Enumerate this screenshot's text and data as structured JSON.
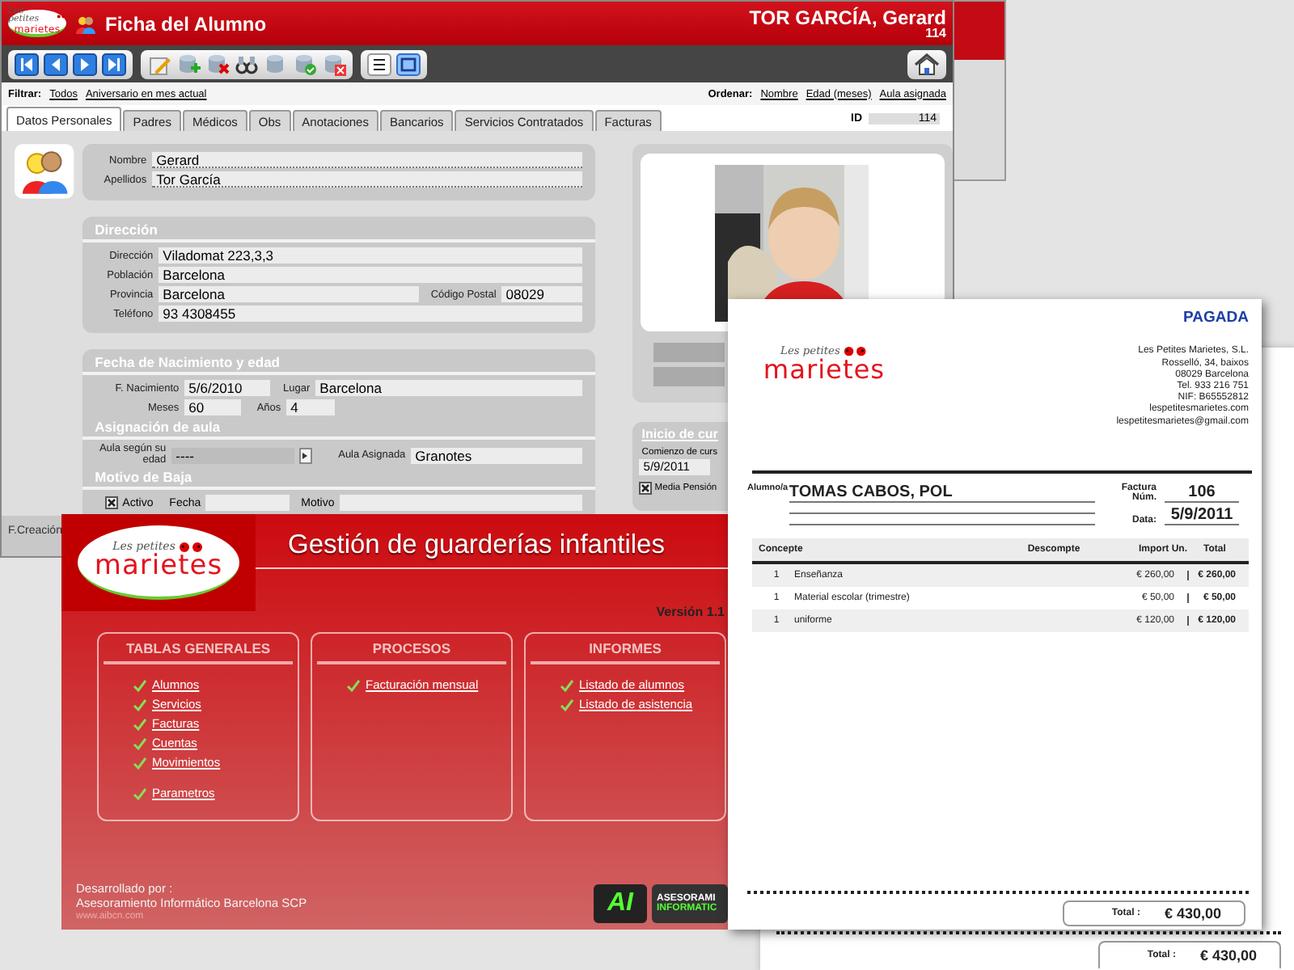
{
  "student_window": {
    "logo": {
      "top": "Les petites",
      "main": "marietes"
    },
    "title": "Ficha del Alumno",
    "student_name": "TOR GARCÍA, Gerard",
    "student_number": "114",
    "view_toggle": [
      {
        "selected": false
      },
      {
        "selected": true
      }
    ],
    "filter": {
      "label": "Filtrar:",
      "options": [
        "Todos",
        "Aniversario en mes actual"
      ]
    },
    "sort": {
      "label": "Ordenar:",
      "options": [
        "Nombre",
        "Edad (meses)",
        "Aula asignada"
      ]
    },
    "tabs": [
      {
        "label": "Datos Personales",
        "selected": true
      },
      {
        "label": "Padres",
        "selected": false
      },
      {
        "label": "Médicos",
        "selected": false
      },
      {
        "label": "Obs",
        "selected": false
      },
      {
        "label": "Anotaciones",
        "selected": false
      },
      {
        "label": "Bancarios",
        "selected": false
      },
      {
        "label": "Servicios Contratados",
        "selected": false
      },
      {
        "label": "Facturas",
        "selected": false
      }
    ],
    "id_label": "ID",
    "id_value": "114",
    "name_fields": [
      {
        "label": "Nombre",
        "value": "Gerard"
      },
      {
        "label": "Apellidos",
        "value": "Tor García"
      }
    ],
    "address": {
      "title": "Dirección",
      "rows": [
        [
          {
            "label": "Dirección",
            "value": "Viladomat 223,3,3"
          }
        ],
        [
          {
            "label": "Población",
            "value": "Barcelona"
          }
        ],
        [
          {
            "label": "Provincia",
            "value": "Barcelona"
          },
          {
            "label": "Código Postal",
            "value": "08029"
          }
        ],
        [
          {
            "label": "Teléfono",
            "value": "93 4308455"
          }
        ]
      ]
    },
    "birth": {
      "title": "Fecha de Nacimiento y edad",
      "date_label": "F. Nacimiento",
      "date": "5/6/2010",
      "place_label": "Lugar",
      "place": "Barcelona",
      "months_label": "Meses",
      "months": "60",
      "years_label": "Años",
      "years": "4"
    },
    "classroom": {
      "title": "Asignación de aula",
      "age_label": "Aula según su edad",
      "age_value": "----",
      "assigned_label": "Aula Asignada",
      "assigned_value": "Granotes"
    },
    "leave": {
      "title": "Motivo de Baja",
      "active": {
        "label": "Activo",
        "checked": true
      },
      "date_label": "Fecha",
      "reason_label": "Motivo"
    },
    "course": {
      "title": "Inicio de cur",
      "start_label": "Comienzo de curs",
      "start_value": "5/9/2011",
      "half_board": {
        "label": "Media Pensión",
        "checked": true
      }
    },
    "status": "F.Creación"
  },
  "menu_window": {
    "logo": {
      "top": "Les petites",
      "main": "marietes"
    },
    "title": "Gestión de guarderías infantiles",
    "version": "Versión 1.1",
    "sections": [
      {
        "title": "TABLAS GENERALES",
        "groups": [
          [
            "Alumnos",
            "Servicios",
            "Facturas",
            "Cuentas",
            "Movimientos"
          ],
          [
            "Parametros"
          ]
        ]
      },
      {
        "title": "PROCESOS",
        "groups": [
          [
            "Facturación mensual"
          ]
        ]
      },
      {
        "title": "INFORMES",
        "groups": [
          [
            "Listado de alumnos",
            "Listado de asistencia"
          ]
        ]
      }
    ],
    "footer": {
      "credit_label": "Desarrollado por :",
      "company": "Asesoramiento Informático Barcelona SCP",
      "url": "www.aibcn.com"
    },
    "badge": {
      "mark": "AI",
      "lines": [
        "ASESORAMI",
        "INFORMATIC"
      ]
    }
  },
  "invoice": {
    "logo": {
      "top": "Les petites",
      "main": "marietes"
    },
    "status": "PAGADA",
    "company_lines": [
      "Les Petites Marietes, S.L.",
      "Rosselló, 34, baixos",
      "08029 Barcelona",
      "Tel. 933 216 751",
      "NIF: B65552812",
      "lespetitesmarietes.com",
      "lespetitesmarietes@gmail.com"
    ],
    "student_label": "Alumno/a",
    "student_name": "TOMAS CABOS, POL",
    "number_label": "Factura Núm.",
    "number": "106",
    "date_label": "Data:",
    "date": "5/9/2011",
    "columns": [
      "Concepte",
      "Descompte",
      "Import Un.",
      "Total"
    ],
    "rows": [
      {
        "quantity": "1",
        "concept": "Enseñanza",
        "unit_price": "€ 260,00",
        "total": "€ 260,00"
      },
      {
        "quantity": "1",
        "concept": "Material escolar (trimestre)",
        "unit_price": "€ 50,00",
        "total": "€ 50,00"
      },
      {
        "quantity": "1",
        "concept": "uniforme",
        "unit_price": "€ 120,00",
        "total": "€ 120,00"
      }
    ],
    "total_label": "Total :",
    "total": "€ 430,00"
  },
  "invoice_back": {
    "total_label": "Total :",
    "total": "€ 430,00"
  }
}
